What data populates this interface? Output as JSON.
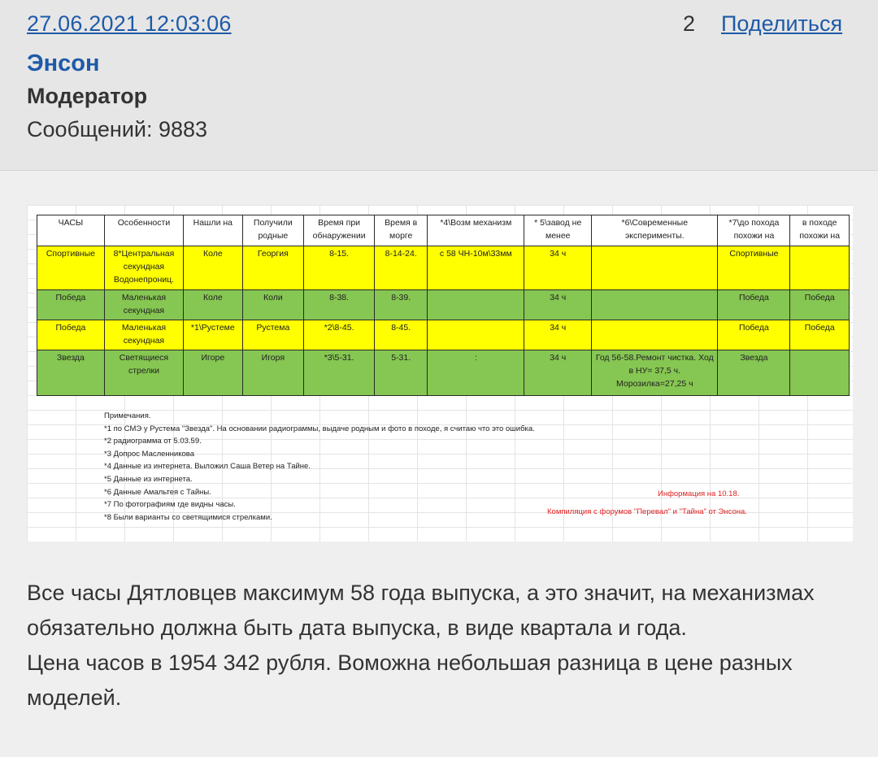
{
  "post": {
    "date": "27.06.2021 12:03:06",
    "number": "2",
    "share_label": "Поделиться",
    "author": "Энсон",
    "role": "Модератор",
    "messages": "Сообщений: 9883"
  },
  "sheet": {
    "headers": [
      "ЧАСЫ",
      "Особенности",
      "Нашли на",
      "Получили родные",
      "Время при обнаружении",
      "Время в морге",
      "*4\\Возм механизм",
      "* 5\\завод не менее",
      "*6\\Современные эксперименты.",
      "*7\\до похода похожи на",
      "в походе похожи на"
    ],
    "rows": [
      [
        "Спортивные",
        "8*Центральная секундная Водонепрониц.",
        "Коле",
        "Георгия",
        "8-15.",
        "8-14-24.",
        "с 58 ЧН-10м\\33мм",
        "34 ч",
        "",
        "Спортивные",
        ""
      ],
      [
        "Победа",
        "Маленькая секундная",
        "Коле",
        "Коли",
        "8-38.",
        "8-39.",
        "",
        "34 ч",
        "",
        "Победа",
        "Победа"
      ],
      [
        "Победа",
        "Маленькая секундная",
        "*1\\Рустеме",
        "Рустема",
        "*2\\8-45.",
        "8-45.",
        "",
        "34 ч",
        "",
        "Победа",
        "Победа"
      ],
      [
        "Звезда",
        "Светящиеся стрелки",
        "Игоре",
        "Игоря",
        "*3\\5-31.",
        "5-31.",
        ":",
        "34 ч",
        "Год 56-58.Ремонт чистка. Ход в НУ= 37,5 ч. Морозилка=27,25 ч",
        "Звезда",
        ""
      ]
    ],
    "notes": [
      "Примечания.",
      "*1 по СМЭ у Рустема \"Звезда\". На основании радиограммы, выдаче родным и фото в походе, я считаю что это ошибка.",
      "*2 радиограмма от 5.03.59.",
      "*3 Допрос Масленникова",
      "*4 Данные из интернета. Выложил Саша Ветер на Тайне.",
      "*5 Данные из интернета.",
      "*6 Данные Амальтея с Тайны.",
      "*7 По фотографиям где видны часы.",
      "*8 Были варианты со светящимися стрелками."
    ],
    "info_red": "Информация на 10.18.",
    "compilation_red": "Компиляция с форумов \"Перевал\" и \"Тайна\" от Энсона."
  },
  "text": {
    "paragraph1": "Все часы Дятловцев максимум 58 года выпуска, а это значит, на механизмах обязательно должна быть дата выпуска, в виде квартала и года.",
    "paragraph2": "Цена часов в 1954 342 рубля. Воможна небольшая разница в цене разных моделей."
  },
  "colors": {
    "link": "#1e5aa8",
    "row_yellow": "#ffff00",
    "row_green": "#86c652",
    "note_red": "#e02020"
  }
}
